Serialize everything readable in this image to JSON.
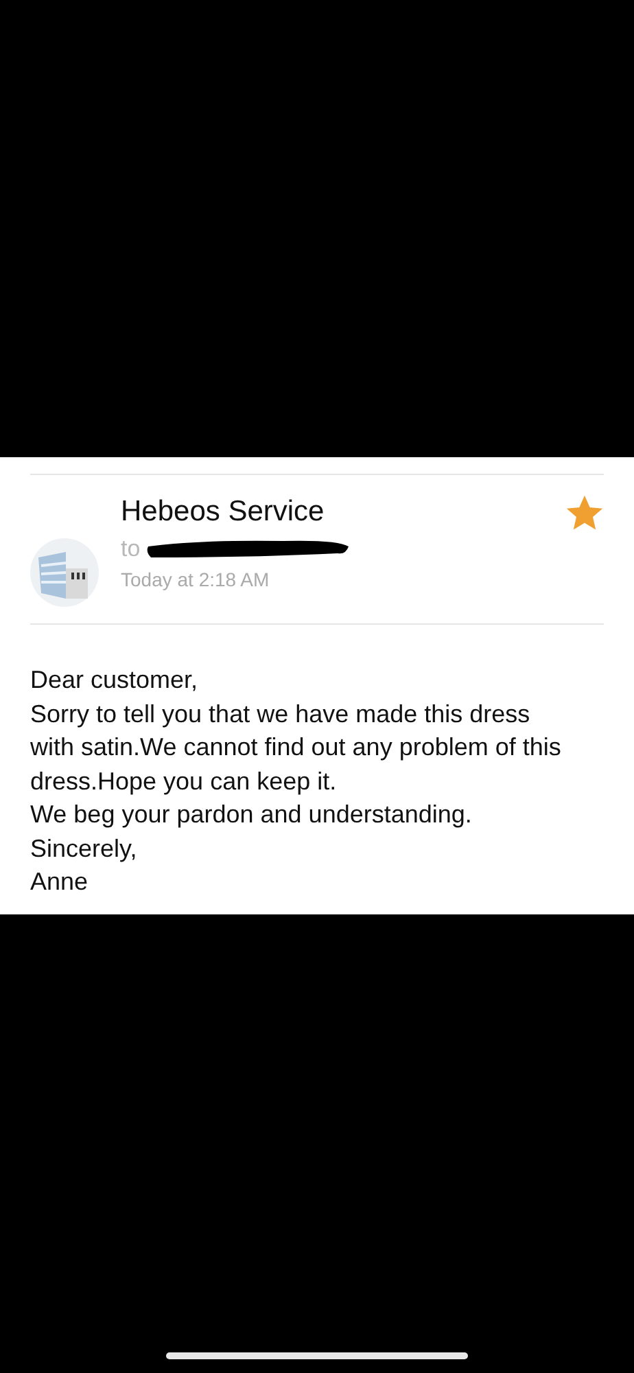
{
  "message": {
    "sender": "Hebeos Service",
    "to_label": "to",
    "recipient_redacted": true,
    "date": "Today at 2:18 AM",
    "starred": true,
    "body": [
      "Dear customer,",
      "Sorry to tell you that we have made this dress with satin.We cannot find out any problem of this dress.Hope you can keep it.",
      "We beg your pardon and understanding.",
      "Sincerely,",
      "Anne"
    ]
  }
}
